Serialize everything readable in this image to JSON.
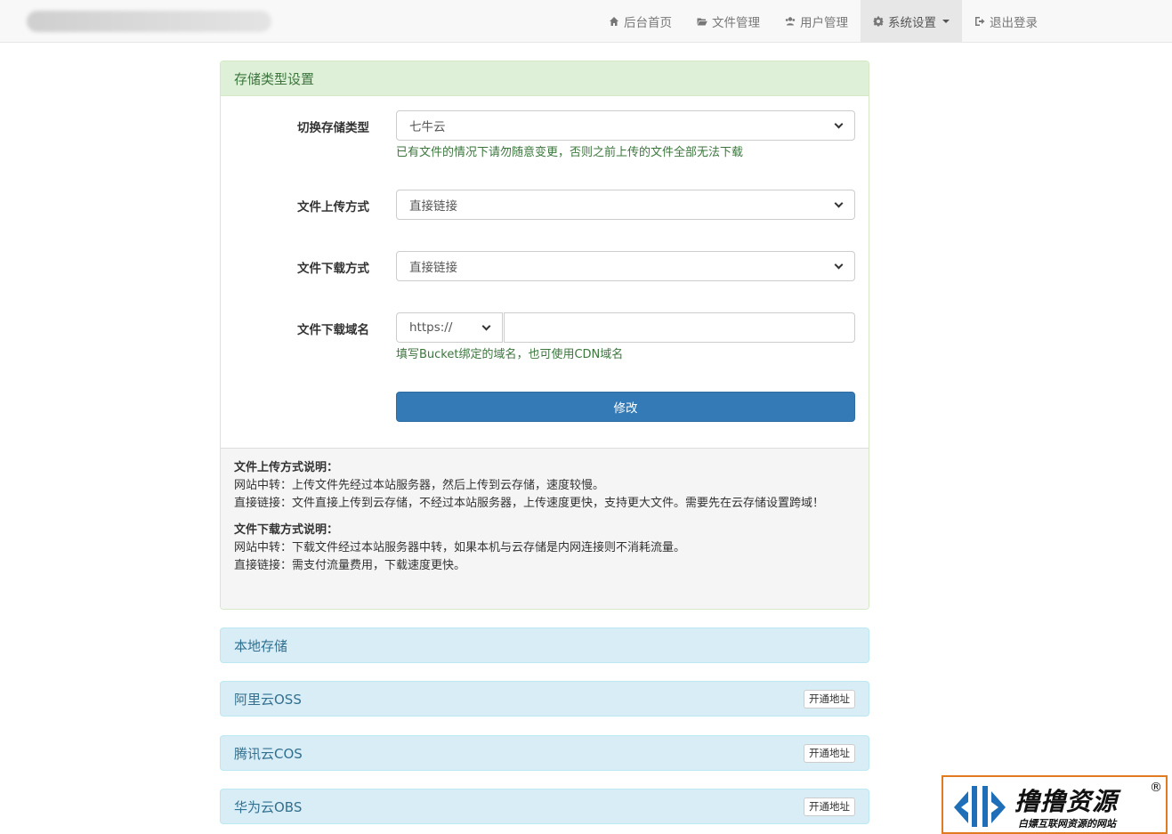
{
  "navbar": {
    "items": [
      {
        "label": "后台首页",
        "icon": "home-icon"
      },
      {
        "label": "文件管理",
        "icon": "folder-open-icon"
      },
      {
        "label": "用户管理",
        "icon": "users-icon"
      },
      {
        "label": "系统设置",
        "icon": "gear-icon",
        "active": true
      },
      {
        "label": "退出登录",
        "icon": "logout-icon"
      }
    ]
  },
  "storage_panel": {
    "title": "存储类型设置",
    "storage_type": {
      "label": "切换存储类型",
      "value": "七牛云",
      "help": "已有文件的情况下请勿随意变更，否则之前上传的文件全部无法下载"
    },
    "upload_method": {
      "label": "文件上传方式",
      "value": "直接链接"
    },
    "download_method": {
      "label": "文件下载方式",
      "value": "直接链接"
    },
    "download_domain": {
      "label": "文件下载域名",
      "protocol": "https://",
      "help": "填写Bucket绑定的域名，也可使用CDN域名"
    },
    "submit_label": "修改",
    "notes": {
      "upload_title": "文件上传方式说明：",
      "upload_relay": "网站中转：上传文件先经过本站服务器，然后上传到云存储，速度较慢。",
      "upload_direct": "直接链接：文件直接上传到云存储，不经过本站服务器，上传速度更快，支持更大文件。需要先在云存储设置跨域！",
      "download_title": "文件下载方式说明：",
      "download_relay": "网站中转：下载文件经过本站服务器中转，如果本机与云存储是内网连接则不消耗流量。",
      "download_direct": "直接链接：需支付流量费用，下载速度更快。"
    }
  },
  "providers": [
    {
      "name": "本地存储"
    },
    {
      "name": "阿里云OSS",
      "action": "开通地址"
    },
    {
      "name": "腾讯云COS",
      "action": "开通地址"
    },
    {
      "name": "华为云OBS",
      "action": "开通地址"
    }
  ],
  "watermark": {
    "title": "撸撸资源",
    "subtitle": "白嫖互联网资源的网站",
    "reg": "®"
  },
  "colors": {
    "primary": "#337ab7",
    "success_bg": "#dff0d8",
    "success_text": "#3c763d",
    "info_bg": "#d9edf7",
    "info_text": "#31708f"
  }
}
